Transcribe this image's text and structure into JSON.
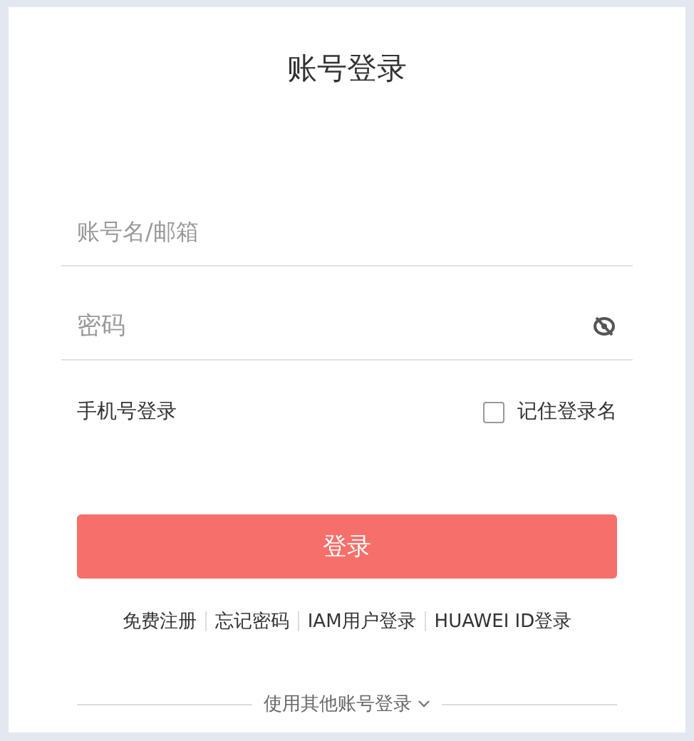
{
  "title": "账号登录",
  "username": {
    "placeholder": "账号名/邮箱"
  },
  "password": {
    "placeholder": "密码"
  },
  "phone_login": "手机号登录",
  "remember": {
    "label": "记住登录名",
    "checked": false
  },
  "submit": "登录",
  "links": [
    {
      "label": "免费注册"
    },
    {
      "label": "忘记密码"
    },
    {
      "label": "IAM用户登录"
    },
    {
      "label": "HUAWEI ID登录"
    }
  ],
  "other_login": "使用其他账号登录"
}
